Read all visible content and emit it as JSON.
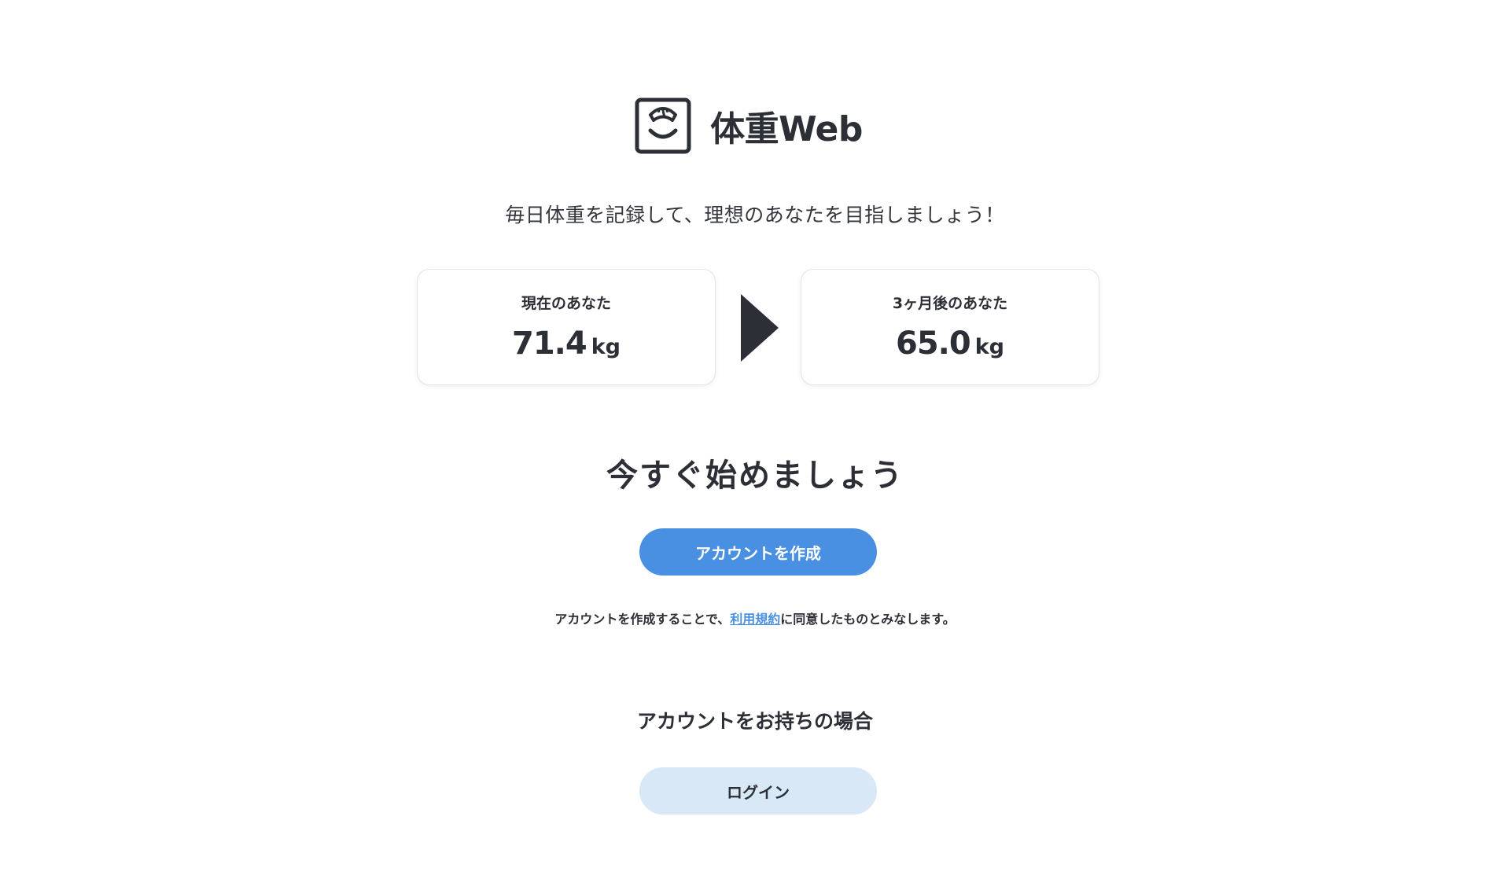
{
  "brand": {
    "name": "体重Web",
    "logo_icon": "scale-icon"
  },
  "tagline": "毎日体重を記録して、理想のあなたを目指しましょう！",
  "comparison": {
    "current": {
      "label": "現在のあなた",
      "value": "71.4",
      "unit": "kg"
    },
    "arrow_icon": "triangle-right-icon",
    "future": {
      "label": "3ヶ月後のあなた",
      "value": "65.0",
      "unit": "kg"
    }
  },
  "cta": {
    "heading": "今すぐ始めましょう",
    "create_account_label": "アカウントを作成",
    "terms_prefix": "アカウントを作成することで、",
    "terms_link": "利用規約",
    "terms_suffix": "に同意したものとみなします。"
  },
  "login": {
    "heading": "アカウントをお持ちの場合",
    "button_label": "ログイン"
  },
  "colors": {
    "primary": "#4a90e2",
    "secondary": "#d8e8f6",
    "text": "#2c2f36"
  }
}
